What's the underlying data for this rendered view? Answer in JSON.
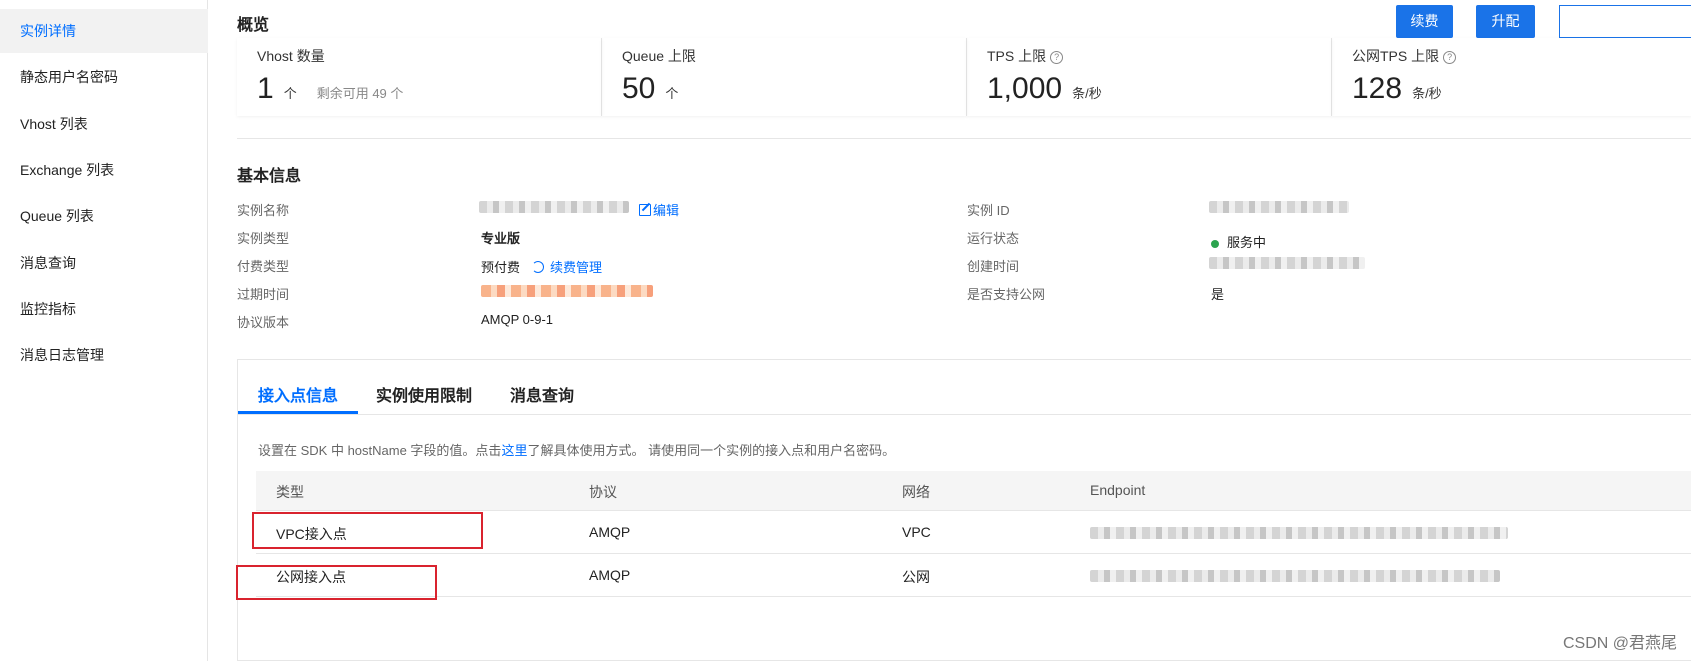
{
  "sidebar": {
    "items": [
      {
        "label": "实例详情",
        "active": true
      },
      {
        "label": "静态用户名密码"
      },
      {
        "label": "Vhost 列表"
      },
      {
        "label": "Exchange 列表"
      },
      {
        "label": "Queue 列表"
      },
      {
        "label": "消息查询"
      },
      {
        "label": "监控指标"
      },
      {
        "label": "消息日志管理"
      }
    ]
  },
  "overview": {
    "title": "概览",
    "buttons": {
      "renew": "续费",
      "upgrade": "升配"
    },
    "stats": [
      {
        "label": "Vhost 数量",
        "value": "1",
        "unit": "个",
        "note": "剩余可用 49 个"
      },
      {
        "label": "Queue 上限",
        "value": "50",
        "unit": "个"
      },
      {
        "label": "TPS 上限",
        "value": "1,000",
        "unit": "条/秒",
        "help": "?"
      },
      {
        "label": "公网TPS 上限",
        "value": "128",
        "unit": "条/秒",
        "help": "?"
      }
    ]
  },
  "basic": {
    "title": "基本信息",
    "left": [
      {
        "label": "实例名称",
        "edit": "编辑"
      },
      {
        "label": "实例类型",
        "value": "专业版"
      },
      {
        "label": "付费类型",
        "value": "预付费",
        "link": "续费管理"
      },
      {
        "label": "过期时间"
      },
      {
        "label": "协议版本",
        "value": "AMQP 0-9-1"
      }
    ],
    "right": [
      {
        "label": "实例 ID"
      },
      {
        "label": "运行状态",
        "value": "服务中"
      },
      {
        "label": "创建时间"
      },
      {
        "label": "是否支持公网",
        "value": "是"
      }
    ]
  },
  "tabs": [
    {
      "label": "接入点信息",
      "active": true
    },
    {
      "label": "实例使用限制"
    },
    {
      "label": "消息查询"
    }
  ],
  "tip": {
    "before": "设置在 SDK 中 hostName 字段的值。点击",
    "link": "这里",
    "after": "了解具体使用方式。 请使用同一个实例的接入点和用户名密码。"
  },
  "table": {
    "columns": [
      "类型",
      "协议",
      "网络",
      "Endpoint"
    ],
    "rows": [
      {
        "type": "VPC接入点",
        "protocol": "AMQP",
        "network": "VPC"
      },
      {
        "type": "公网接入点",
        "protocol": "AMQP",
        "network": "公网"
      }
    ]
  },
  "watermark": "CSDN @君燕尾",
  "colors": {
    "accent": "#006eff",
    "button": "#1a73e8",
    "highlight_box": "#d9232e",
    "status_ok": "#2ba44e"
  }
}
